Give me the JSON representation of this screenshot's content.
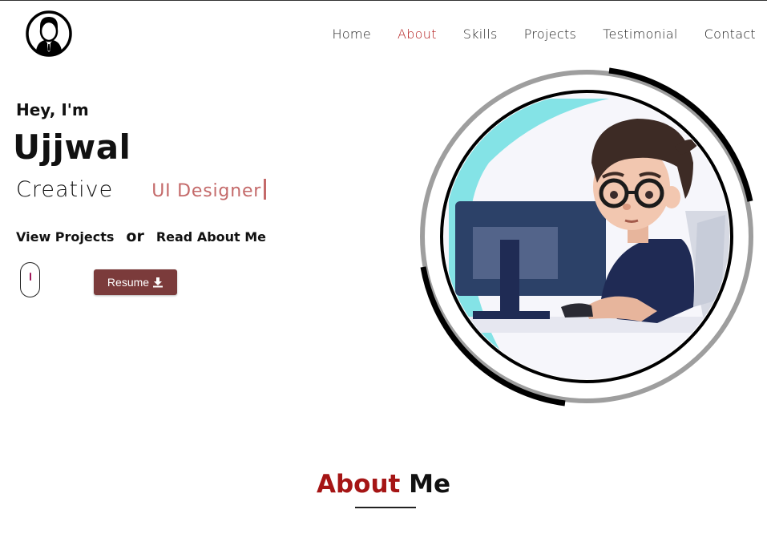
{
  "nav": {
    "logo_icon": "user-avatar-icon",
    "items": [
      {
        "label": "Home",
        "active": false
      },
      {
        "label": "About",
        "active": true
      },
      {
        "label": "Skills",
        "active": false
      },
      {
        "label": "Projects",
        "active": false
      },
      {
        "label": "Testimonial",
        "active": false
      },
      {
        "label": "Contact",
        "active": false
      }
    ],
    "active_color": "#b31b1b"
  },
  "hero": {
    "greeting": "Hey, I'm",
    "name": "Ujjwal",
    "role_prefix": "Creative",
    "role_typed": "UI Designer",
    "typed_color": "#c46a6a",
    "link_projects": "View Projects",
    "link_or": "or",
    "link_about": "Read About Me",
    "scroll_icon": "mouse-scroll-icon",
    "resume_label": "Resume",
    "resume_icon": "download-icon",
    "resume_color": "#7b3b3b",
    "illustration": "developer-at-computer-illustration"
  },
  "about": {
    "title_accent": "About",
    "title_rest": "Me",
    "accent_color": "#a51515"
  }
}
